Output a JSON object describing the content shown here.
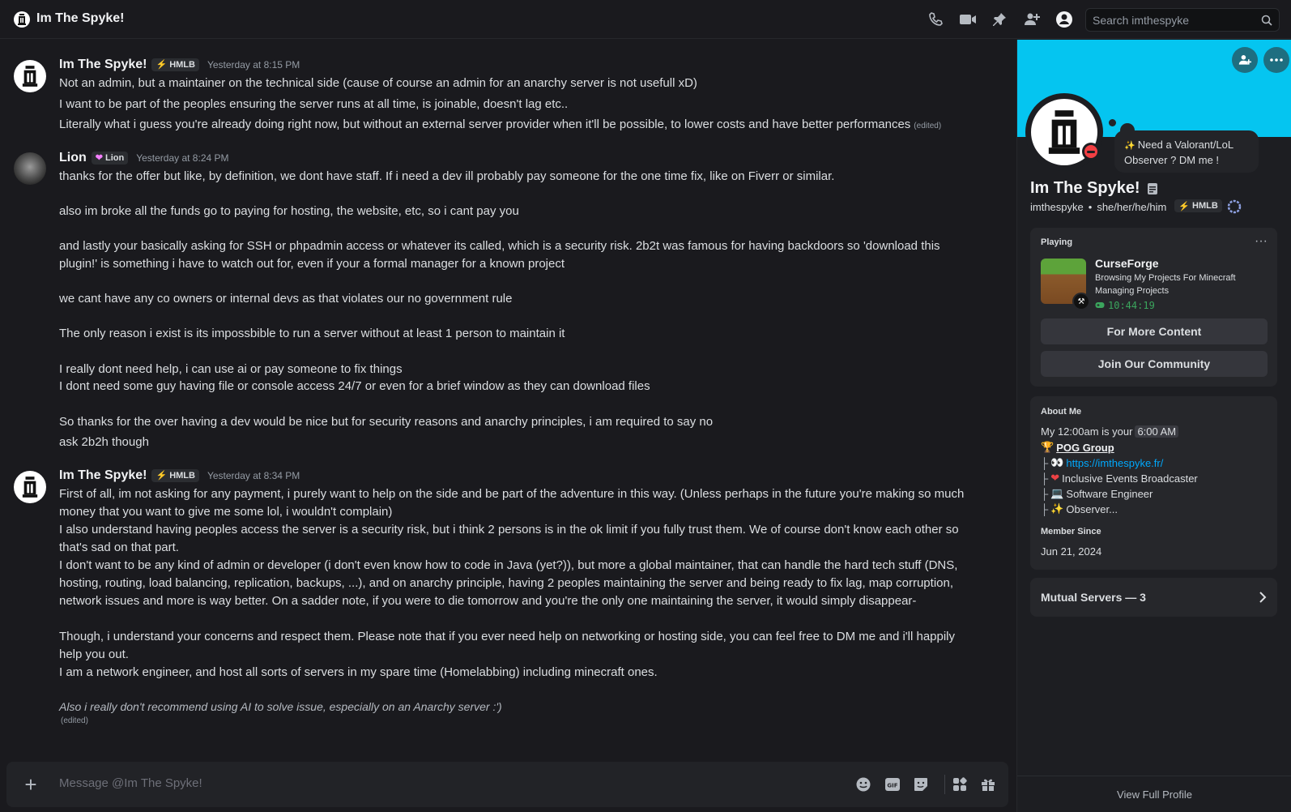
{
  "topbar": {
    "title": "Im The Spyke!",
    "search_placeholder": "Search imthespyke"
  },
  "messages": [
    {
      "author": "Im The Spyke!",
      "tag": "HMLB",
      "timestamp": "Yesterday at 8:15 PM",
      "lines": [
        "Not an admin, but a maintainer on the technical side (cause of course an admin for an anarchy server is not usefull xD)",
        "I want to be part of the peoples ensuring the server runs at all time, is joinable, doesn't lag etc..",
        "Literally what i guess you're already doing right now, but without an external server provider when it'll be possible, to lower costs and have better performances"
      ],
      "edited": "(edited)"
    },
    {
      "author": "Lion",
      "tag": "Lion",
      "timestamp": "Yesterday at 8:24 PM",
      "lines": [
        "thanks for the offer but like, by definition, we dont have staff. If i need a dev ill probably pay someone for the one time fix, like on Fiverr or similar.",
        "also im broke all the funds go to paying for hosting, the website, etc, so i cant pay you",
        "and lastly your basically asking for SSH or phpadmin access or whatever its called, which is a security risk. 2b2t was famous for having backdoors so 'download this",
        "plugin!' is something i have to watch out for, even if your a formal manager for a known project",
        "we cant have any co owners or internal devs as that violates our no government rule",
        "The only reason i exist is its impossbible to run a server without at least 1 person to maintain it",
        "I really dont need help, i can use ai or pay someone to fix things",
        "I dont need some guy having file or console access 24/7 or even for a brief window as they can download files",
        "So thanks for the over having a dev would be nice but for security reasons and anarchy principles, i am required to say no",
        "ask 2b2h though"
      ]
    },
    {
      "author": "Im The Spyke!",
      "tag": "HMLB",
      "timestamp": "Yesterday at 8:34 PM",
      "lines": [
        "First of all, im not asking for any payment, i purely want to help on the side and be part of the adventure in this way. (Unless perhaps in the future you're making so much",
        "money that you want to give me some lol, i wouldn't complain)",
        "I also understand having peoples access the server is a security risk, but i think 2 persons is in the ok limit if you fully trust them. We of course don't know each other so",
        "that's sad on that part.",
        "I don't want to be any kind of admin or developer (i don't even know how to code in Java (yet?)), but more a global maintainer, that can handle the hard tech stuff (DNS,",
        "hosting, routing, load balancing, replication, backups, ...), and on anarchy principle, having 2 peoples maintaining the server and being ready to fix lag, map corruption,",
        "network issues and more is way better. On a sadder note, if you were to die tomorrow and you're the only one maintaining the server, it would simply disappear-",
        "Though, i understand your concerns and respect them. Please note that if you ever need help on networking or hosting side, you can feel free to DM me and i'll happily",
        "help you out.",
        "I am a network engineer, and host all sorts of servers in my spare time (Homelabbing) including minecraft ones.",
        "Also i really don't recommend using AI to solve issue, especially on an Anarchy server :')"
      ],
      "edited": "(edited)"
    }
  ],
  "composer": {
    "placeholder": "Message @Im The Spyke!"
  },
  "profile": {
    "status_bubble": "Need a Valorant/LoL Observer ? DM me !",
    "display_name": "Im The Spyke!",
    "username": "imthespyke",
    "pronouns": "she/her/he/him",
    "separator": "•",
    "tag": "HMLB",
    "playing": {
      "heading": "Playing",
      "game": "CurseForge",
      "details": "Browsing My Projects For Minecraft",
      "state": "Managing Projects",
      "elapsed": "10:44:19",
      "button1": "For More Content",
      "button2": "Join Our Community"
    },
    "about": {
      "heading": "About Me",
      "line1_prefix": "My 12:00am is your",
      "line1_time": "6:00 AM",
      "group": "POG Group",
      "link": "https://imthespyke.fr/",
      "item2": "Inclusive Events Broadcaster",
      "item3": "Software Engineer",
      "item4": "Observer...",
      "member_since_heading": "Member Since",
      "member_since": "Jun 21, 2024"
    },
    "mutual": "Mutual Servers — 3",
    "view_full": "View Full Profile"
  },
  "colors": {
    "banner": "#05c5f0",
    "dnd": "#f23f43",
    "link": "#00a8fc"
  }
}
